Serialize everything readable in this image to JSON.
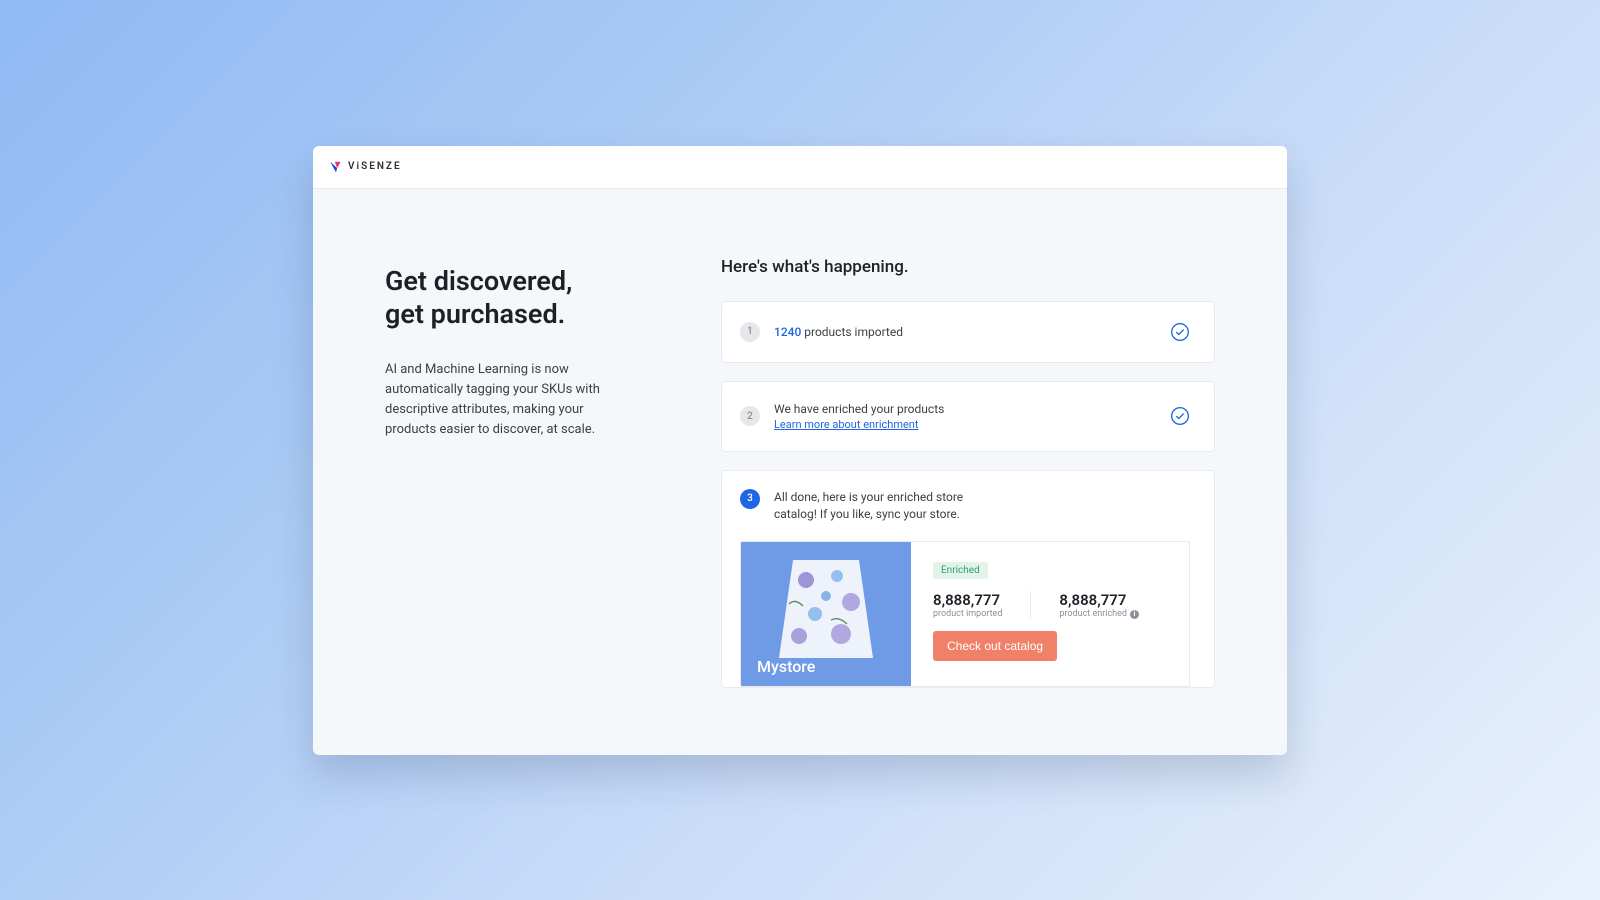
{
  "brand": {
    "name": "ViSENZE"
  },
  "left": {
    "headline": "Get discovered,\nget purchased.",
    "subtext": "AI and Machine Learning is now automatically tagging your SKUs with descriptive attributes, making your products easier to discover, at scale."
  },
  "right": {
    "heading": "Here's what's happening."
  },
  "steps": {
    "s1": {
      "badge": "1",
      "count": "1240",
      "suffix": " products imported"
    },
    "s2": {
      "badge": "2",
      "line": "We have enriched your products",
      "link": "Learn more about enrichment"
    },
    "s3": {
      "badge": "3",
      "text": "All done, here is your enriched store catalog! If you like, sync your store."
    }
  },
  "catalog": {
    "store_name": "Mystore",
    "status_badge": "Enriched",
    "stat1_value": "8,888,777",
    "stat1_label": "product imported",
    "stat2_value": "8,888,777",
    "stat2_label": "product enriched",
    "cta": "Check out catalog"
  }
}
